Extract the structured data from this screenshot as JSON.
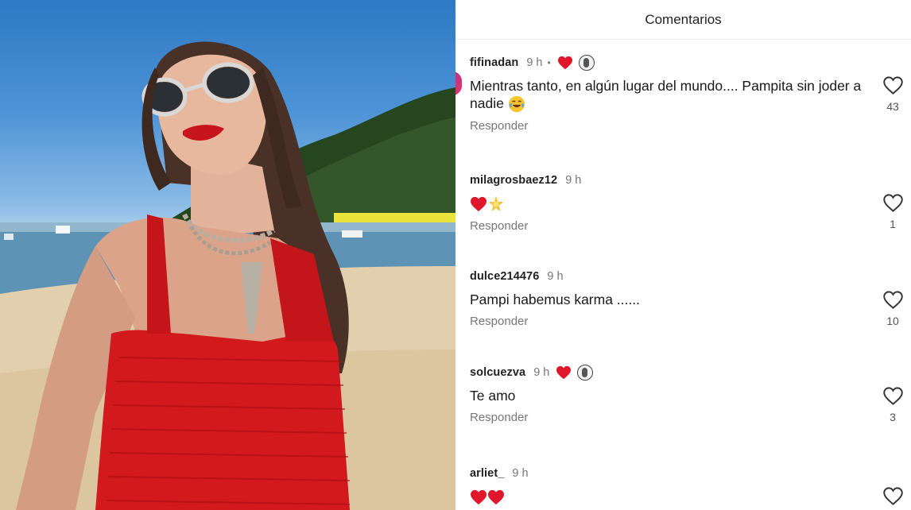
{
  "panel": {
    "title": "Comentarios"
  },
  "icons": {
    "like": "heart-outline-icon",
    "liked_by_author": "heart-filled-icon",
    "author_avatar": "avatar-icon"
  },
  "colors": {
    "heart": "#e0162b",
    "dress": "#d2191d",
    "sky": "#4d93d6",
    "sand": "#e2cfae"
  },
  "comments": [
    {
      "user": "fifinadan",
      "time": "9 h",
      "author_liked": true,
      "text": "Mientras tanto, en algún lugar del mundo.... Pampita sin joder a nadie",
      "emoji": "face-with-tears-of-joy",
      "reply": "Responder",
      "likes": "43"
    },
    {
      "user": "milagrosbaez12",
      "time": "9 h",
      "author_liked": false,
      "text": "",
      "emoji": "red-heart, glowing-star",
      "reply": "Responder",
      "likes": "1"
    },
    {
      "user": "dulce214476",
      "time": "9 h",
      "author_liked": false,
      "text": "Pampi habemus karma ......",
      "emoji": "",
      "reply": "Responder",
      "likes": "10"
    },
    {
      "user": "solcuezva",
      "time": "9 h",
      "author_liked": true,
      "text": "Te amo",
      "emoji": "",
      "reply": "Responder",
      "likes": "3"
    },
    {
      "user": "arliet_",
      "time": "9 h",
      "author_liked": false,
      "text": "",
      "emoji": "two-red-hearts",
      "reply": "",
      "likes": ""
    }
  ]
}
